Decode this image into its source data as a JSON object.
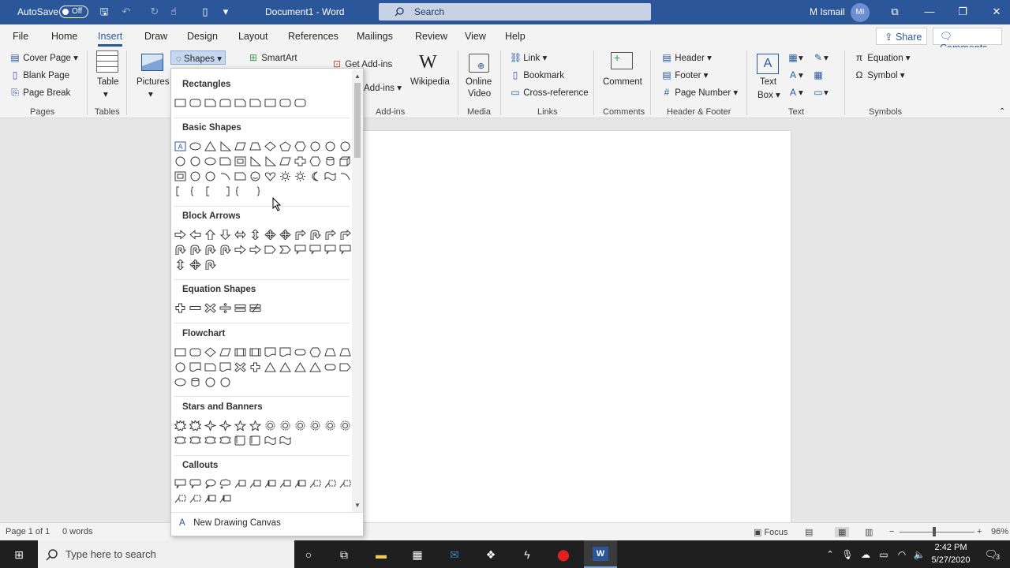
{
  "titlebar": {
    "autosave_label": "AutoSave",
    "autosave_state": "Off",
    "document_title": "Document1 - Word",
    "search_label": "Search",
    "user_name": "M Ismail",
    "user_initials": "MI"
  },
  "menu": {
    "tabs": [
      "File",
      "Home",
      "Insert",
      "Draw",
      "Design",
      "Layout",
      "References",
      "Mailings",
      "Review",
      "View",
      "Help"
    ],
    "active": "Insert",
    "share_label": "Share",
    "comments_label": "Comments"
  },
  "ribbon": {
    "pages": {
      "cover_page": "Cover Page",
      "blank_page": "Blank Page",
      "page_break": "Page Break",
      "label": "Pages"
    },
    "tables": {
      "table": "Table",
      "label": "Tables"
    },
    "illustrations": {
      "pictures": "Pictures",
      "shapes": "Shapes",
      "smartart": "SmartArt"
    },
    "addins": {
      "get_addins": "Get Add-ins",
      "my_addins": "Add-ins",
      "wikipedia": "Wikipedia",
      "label": "Add-ins"
    },
    "media": {
      "online_video_1": "Online",
      "online_video_2": "Video",
      "label": "Media"
    },
    "links": {
      "link": "Link",
      "bookmark": "Bookmark",
      "cross_reference": "Cross-reference",
      "label": "Links"
    },
    "comments": {
      "comment": "Comment",
      "label": "Comments"
    },
    "header_footer": {
      "header": "Header",
      "footer": "Footer",
      "page_number": "Page Number",
      "label": "Header & Footer"
    },
    "text": {
      "text_box_1": "Text",
      "text_box_2": "Box",
      "label": "Text"
    },
    "symbols": {
      "equation": "Equation",
      "symbol": "Symbol",
      "label": "Symbols"
    }
  },
  "gallery": {
    "categories": [
      "Rectangles",
      "Basic Shapes",
      "Block Arrows",
      "Equation Shapes",
      "Flowchart",
      "Stars and Banners",
      "Callouts"
    ],
    "new_canvas": "New Drawing Canvas"
  },
  "status": {
    "page": "Page 1 of 1",
    "words": "0 words",
    "focus": "Focus",
    "zoom": "96%"
  },
  "taskbar": {
    "search_placeholder": "Type here to search",
    "time": "2:42 PM",
    "date": "5/27/2020",
    "notifications": "3"
  }
}
